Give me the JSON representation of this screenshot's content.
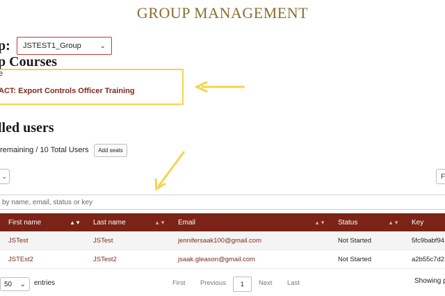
{
  "header": {
    "title": "GROUP MANAGEMENT"
  },
  "group": {
    "label": "p:",
    "selected": "JSTEST1_Group"
  },
  "courses": {
    "heading": "p Courses",
    "column_label": "e",
    "items": [
      {
        "name": "ACT: Export Controls Officer Training"
      }
    ]
  },
  "enrolled": {
    "heading": "lled users",
    "seats_text": "remaining / 10 Total Users",
    "add_seats_label": "Add seats"
  },
  "search": {
    "placeholder": "by name, email, status or key"
  },
  "table": {
    "columns": [
      "First name",
      "Last name",
      "Email",
      "Status",
      "Key"
    ],
    "rows": [
      {
        "first": "JSTest",
        "last": "JSTest",
        "email": "jennifersaak100@gmail.com",
        "status": "Not Started",
        "key": "5fc9babf94"
      },
      {
        "first": "JSTEst2",
        "last": "JSTest2",
        "email": "jsaak.gleason@gmail.com",
        "status": "Not Started",
        "key": "a2b55c7d2"
      }
    ]
  },
  "controls": {
    "top_right_label": "F"
  },
  "footer": {
    "page_length": "50",
    "entries_label": "entries",
    "first": "First",
    "previous": "Previous",
    "current_page": "1",
    "next": "Next",
    "last": "Last",
    "showing": "Showing p"
  },
  "colors": {
    "accent": "#7b2317",
    "title": "#8a6d2f",
    "highlight": "#f3d44a",
    "select_border": "#c0392b"
  },
  "icons": [
    "chevron-down-icon",
    "sort-icon",
    "arrow-annotation-icon"
  ]
}
